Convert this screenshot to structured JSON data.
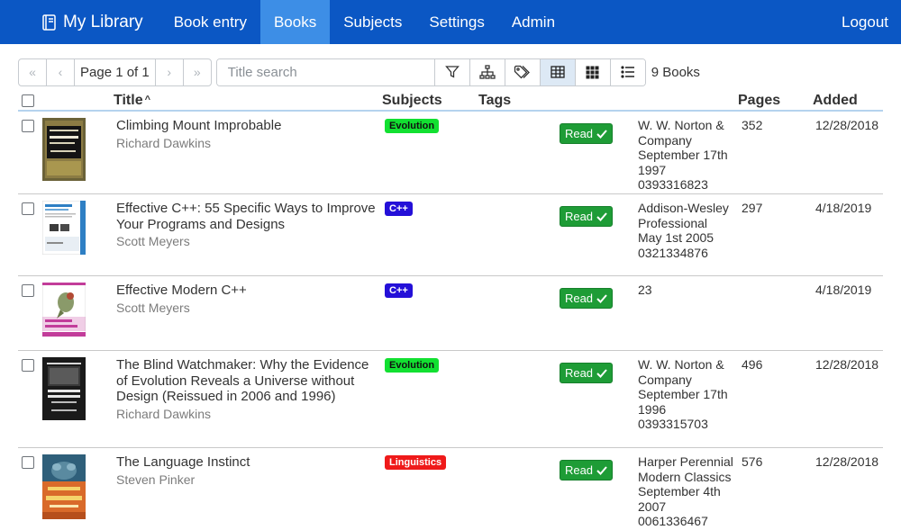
{
  "nav": {
    "brand": "My Library",
    "links": [
      "Book entry",
      "Books",
      "Subjects",
      "Settings",
      "Admin"
    ],
    "logout": "Logout",
    "brand_color": "#0b57c4",
    "active_color": "#3d8ee6"
  },
  "toolbar": {
    "first_icon": "first-page-icon",
    "prev_icon": "prev-page-icon",
    "page_label": "Page 1 of 1",
    "next_icon": "next-page-icon",
    "last_icon": "last-page-icon",
    "search_placeholder": "Title search",
    "filter_icon": "filter-icon",
    "hierarchy_icon": "hierarchy-icon",
    "tags_icon": "tags-icon",
    "table_view_icon": "table-view-icon",
    "grid_view_icon": "grid-view-icon",
    "list_view_icon": "list-view-icon",
    "book_count": "9 Books"
  },
  "table": {
    "headers": {
      "title": "Title",
      "subjects": "Subjects",
      "tags": "Tags",
      "pages": "Pages",
      "added": "Added"
    },
    "sort_indicator": "^",
    "rows": [
      {
        "title": "Climbing Mount Improbable",
        "author": "Richard Dawkins",
        "subject": "Evolution",
        "subject_color": "#12e031",
        "status": "Read",
        "publisher": "W. W. Norton & Company",
        "published": "September 17th 1997",
        "isbn": "0393316823",
        "pages": "352",
        "added": "12/28/2018"
      },
      {
        "title": "Effective C++: 55 Specific Ways to Improve Your Programs and Designs",
        "author": "Scott Meyers",
        "subject": "C++",
        "subject_color": "#2410d8",
        "status": "Read",
        "publisher": "Addison-Wesley Professional",
        "published": "May 1st 2005",
        "isbn": "0321334876",
        "pages": "297",
        "added": "4/18/2019"
      },
      {
        "title": "Effective Modern C++",
        "author": "Scott Meyers",
        "subject": "C++",
        "subject_color": "#2410d8",
        "status": "Read",
        "publisher": "",
        "published": "",
        "isbn": "23",
        "pages": "",
        "added": "4/18/2019"
      },
      {
        "title": "The Blind Watchmaker: Why the Evidence of Evolution Reveals a Universe without Design (Reissued in 2006 and 1996)",
        "author": "Richard Dawkins",
        "subject": "Evolution",
        "subject_color": "#12e031",
        "status": "Read",
        "publisher": "W. W. Norton & Company",
        "published": "September 17th 1996",
        "isbn": "0393315703",
        "pages": "496",
        "added": "12/28/2018"
      },
      {
        "title": "The Language Instinct",
        "author": "Steven Pinker",
        "subject": "Linguistics",
        "subject_color": "#ef1a1a",
        "status": "Read",
        "publisher": "Harper Perennial Modern Classics",
        "published": "September 4th 2007",
        "isbn": "0061336467",
        "pages": "576",
        "added": "12/28/2018"
      }
    ]
  }
}
